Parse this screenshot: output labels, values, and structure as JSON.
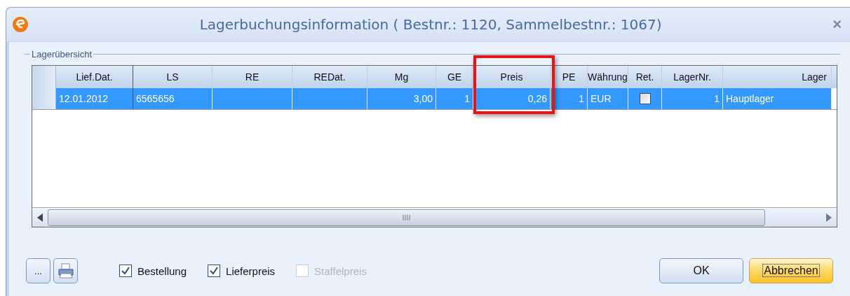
{
  "window": {
    "title": "Lagerbuchungsinformation ( Bestnr.: 1120,  Sammelbestnr.: 1067)",
    "close": "×"
  },
  "group_box": {
    "label": "Lagerübersicht"
  },
  "table": {
    "columns": [
      {
        "label": "Lief.Dat."
      },
      {
        "label": "LS"
      },
      {
        "label": "RE"
      },
      {
        "label": "REDat."
      },
      {
        "label": "Mg"
      },
      {
        "label": "GE"
      },
      {
        "label": "Preis"
      },
      {
        "label": "PE"
      },
      {
        "label": "Währung"
      },
      {
        "label": "Ret."
      },
      {
        "label": "LagerNr."
      },
      {
        "label": "Lager"
      }
    ],
    "rows": [
      {
        "selected": true,
        "cells": [
          {
            "kind": "text",
            "text": "12.01.2012"
          },
          {
            "kind": "text",
            "text": "6565656"
          },
          {
            "kind": "empty"
          },
          {
            "kind": "empty"
          },
          {
            "kind": "text",
            "text": "3,00"
          },
          {
            "kind": "text",
            "text": "1"
          },
          {
            "kind": "text",
            "text": "0,26"
          },
          {
            "kind": "text",
            "text": "1"
          },
          {
            "kind": "text",
            "text": "EUR"
          },
          {
            "kind": "checkbox",
            "checked": false
          },
          {
            "kind": "text",
            "text": "1"
          },
          {
            "kind": "text",
            "text": "Hauptlager"
          }
        ]
      }
    ]
  },
  "tool_buttons": [
    {
      "kind": "text",
      "label": "..."
    },
    {
      "kind": "printer"
    }
  ],
  "checkboxes": [
    {
      "label": "Bestellung",
      "checked": true,
      "disabled": false
    },
    {
      "label": "Lieferpreis",
      "checked": true,
      "disabled": false
    },
    {
      "label": "Staffelpreis",
      "checked": false,
      "disabled": true
    }
  ],
  "buttons": [
    {
      "label": "OK",
      "focused": false
    },
    {
      "label": "Abbrechen",
      "focused": true
    }
  ]
}
